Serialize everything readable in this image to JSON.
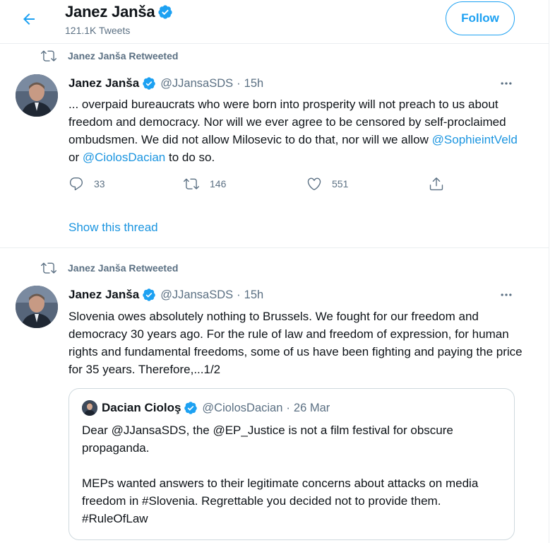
{
  "header": {
    "name": "Janez Janša",
    "tweets_count": "121.1K Tweets",
    "follow_label": "Follow"
  },
  "colors": {
    "accent": "#1da1f2",
    "link": "#1b95e0",
    "secondary_text": "#5b7083",
    "border": "#ebeef0"
  },
  "icons": {
    "back": "back-arrow-icon",
    "verified": "verified-badge-icon",
    "retweet": "retweet-icon",
    "reply": "reply-icon",
    "like": "heart-icon",
    "share": "share-icon",
    "more": "more-horizontal-icon"
  },
  "tweets": [
    {
      "retweet_label": "Janez Janša Retweeted",
      "author_name": "Janez Janša",
      "handle": "@JJansaSDS",
      "separator": "·",
      "time": "15h",
      "text_parts": [
        "... overpaid bureaucrats who were born into prosperity will not preach to us about freedom and democracy.  Nor will we ever agree to be censored by self-proclaimed ombudsmen.  We did not allow Milosevic to do that, nor will we allow ",
        "@SophieintVeld",
        " or ",
        "@CiolosDacian",
        " to do so."
      ],
      "reply_count": "33",
      "retweet_count": "146",
      "like_count": "551",
      "show_thread": "Show this thread"
    },
    {
      "retweet_label": "Janez Janša Retweeted",
      "author_name": "Janez Janša",
      "handle": "@JJansaSDS",
      "separator": "·",
      "time": "15h",
      "text": "Slovenia owes absolutely nothing to Brussels.  We fought for our freedom and democracy 30 years ago.  For the rule of law and freedom of expression, for human rights and fundamental freedoms, some of us have been fighting and paying the price for 35 years.  Therefore,...1/2",
      "quote": {
        "author_name": "Dacian Cioloş",
        "handle": "@CiolosDacian",
        "separator": "·",
        "date": "26 Mar",
        "para1": "Dear @JJansaSDS, the @EP_Justice is not a film festival for obscure propaganda.",
        "para2": "MEPs wanted answers to their legitimate concerns about attacks on media freedom in #Slovenia. Regrettable you decided not to provide them. #RuleOfLaw"
      }
    }
  ]
}
